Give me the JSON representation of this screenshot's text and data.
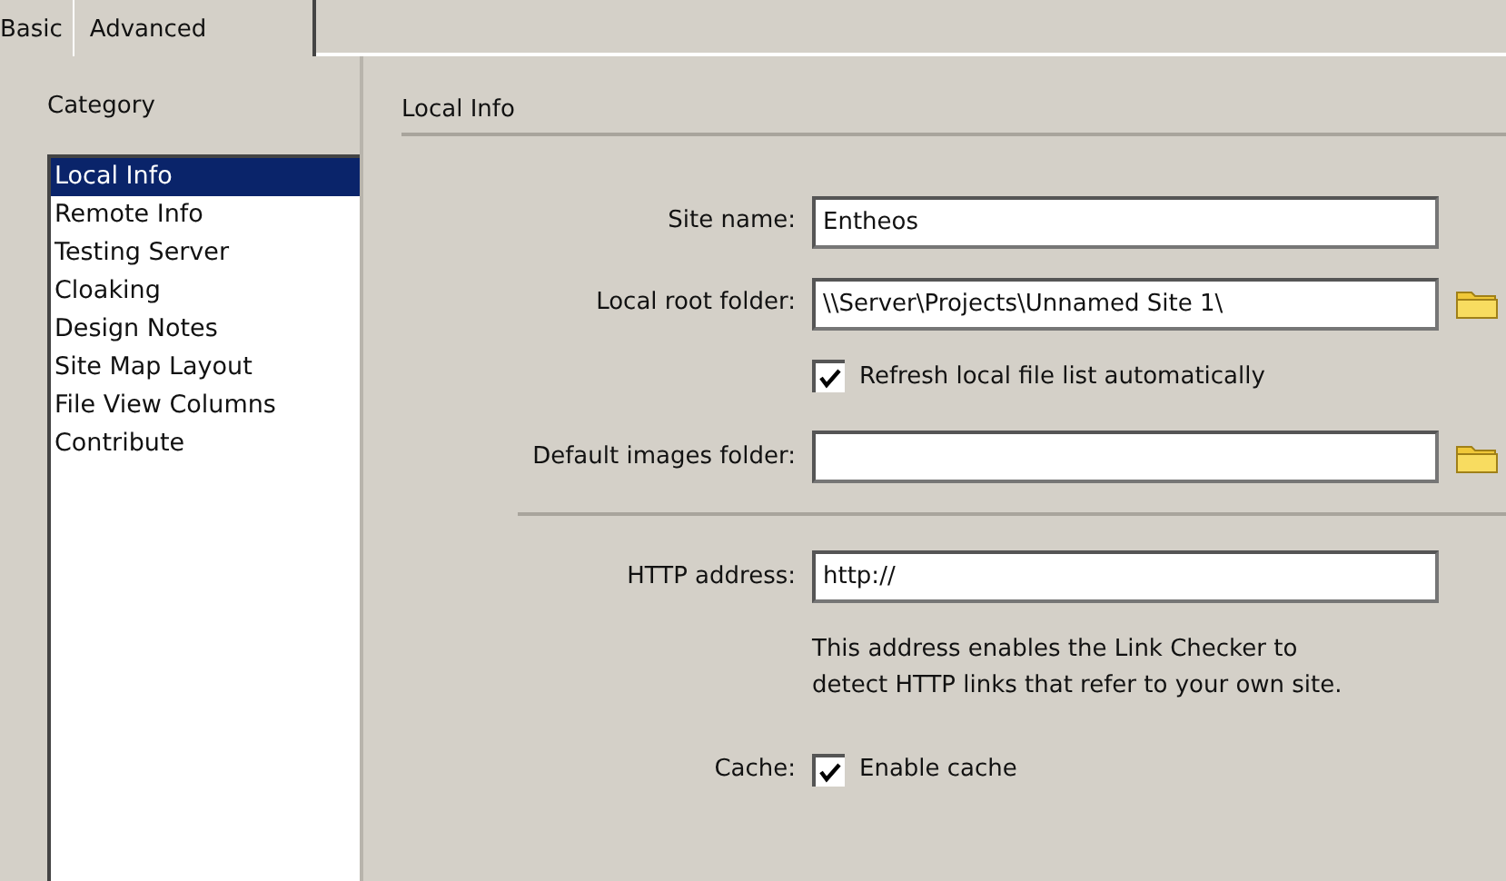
{
  "tabs": [
    {
      "label": "Basic",
      "selected": false
    },
    {
      "label": "Advanced",
      "selected": true
    }
  ],
  "category": {
    "label": "Category",
    "items": [
      {
        "label": "Local Info",
        "selected": true
      },
      {
        "label": "Remote Info",
        "selected": false
      },
      {
        "label": "Testing Server",
        "selected": false
      },
      {
        "label": "Cloaking",
        "selected": false
      },
      {
        "label": "Design Notes",
        "selected": false
      },
      {
        "label": "Site Map Layout",
        "selected": false
      },
      {
        "label": "File View Columns",
        "selected": false
      },
      {
        "label": "Contribute",
        "selected": false
      }
    ]
  },
  "section_title": "Local Info",
  "form_rows": [
    {
      "kind": "text",
      "label": "Site name:",
      "value": "Entheos",
      "browse": false
    },
    {
      "kind": "text",
      "label": "Local root folder:",
      "value": "\\\\Server\\Projects\\Unnamed Site 1\\",
      "browse": true
    },
    {
      "kind": "checkbox",
      "text": "Refresh local file list automatically",
      "checked": true
    },
    {
      "kind": "text",
      "label": "Default images folder:",
      "value": "",
      "browse": true
    },
    {
      "kind": "divider"
    },
    {
      "kind": "text",
      "label": "HTTP address:",
      "value": "http://",
      "browse": false
    },
    {
      "kind": "note",
      "text": "This address enables the Link Checker to detect HTTP links that refer to your own site."
    },
    {
      "kind": "checkbox",
      "label": "Cache:",
      "text": "Enable cache",
      "checked": true
    }
  ]
}
